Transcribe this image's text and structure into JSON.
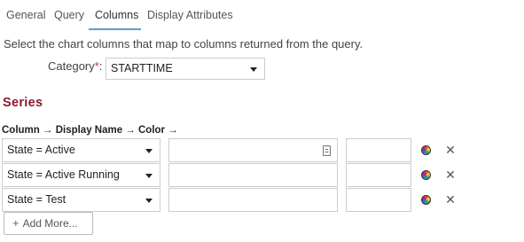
{
  "tabs": [
    {
      "label": "General"
    },
    {
      "label": "Query"
    },
    {
      "label": "Columns"
    },
    {
      "label": "Display Attributes"
    }
  ],
  "active_tab": "Columns",
  "description": "Select the chart columns that map to columns returned from the query.",
  "category": {
    "label": "Category",
    "required_mark": "*",
    "colon": ":",
    "value": "STARTTIME"
  },
  "series": {
    "heading": "Series",
    "column_header": "Column → Display Name → Color →",
    "rows": [
      {
        "column": "State = Active",
        "display_name": "",
        "color": ""
      },
      {
        "column": "State = Active Running",
        "display_name": "",
        "color": ""
      },
      {
        "column": "State = Test",
        "display_name": "",
        "color": ""
      }
    ],
    "remove_glyph": "✕"
  },
  "add_more": {
    "plus": "+",
    "label": "Add More..."
  },
  "colors": {
    "accent_underline": "#5aa0c8",
    "series_heading": "#8b1a2e",
    "required": "#c0392b"
  }
}
